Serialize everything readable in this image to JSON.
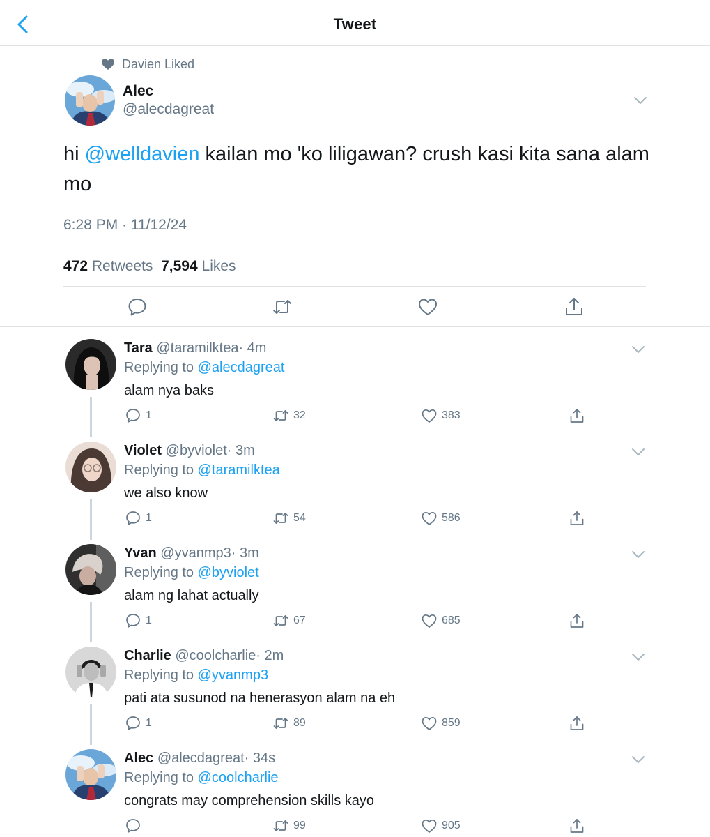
{
  "header": {
    "title": "Tweet"
  },
  "social_context": {
    "text": "Davien Liked"
  },
  "tweet": {
    "name": "Alec",
    "handle": "@alecdagreat",
    "text_prefix": "hi ",
    "mention": "@welldavien",
    "text_suffix": " kailan mo 'ko liligawan? crush kasi kita sana alam mo",
    "timestamp": "6:28 PM · 11/12/24",
    "retweets_count": "472",
    "retweets_label": "Retweets",
    "likes_count": "7,594",
    "likes_label": "Likes"
  },
  "replies": [
    {
      "name": "Tara",
      "handle": "@taramilktea",
      "time": "· 4m",
      "replying_label": "Replying to",
      "replying_to": "@alecdagreat",
      "text": "alam nya baks",
      "comments": "1",
      "retweets": "32",
      "likes": "383"
    },
    {
      "name": "Violet",
      "handle": "@byviolet",
      "time": "· 3m",
      "replying_label": "Replying to",
      "replying_to": "@taramilktea",
      "text": "we also know",
      "comments": "1",
      "retweets": "54",
      "likes": "586"
    },
    {
      "name": "Yvan",
      "handle": "@yvanmp3",
      "time": "· 3m",
      "replying_label": "Replying to",
      "replying_to": "@byviolet",
      "text": "alam ng lahat actually",
      "comments": "1",
      "retweets": "67",
      "likes": "685"
    },
    {
      "name": "Charlie",
      "handle": "@coolcharlie",
      "time": "· 2m",
      "replying_label": "Replying to",
      "replying_to": "@yvanmp3",
      "text": "pati ata susunod na henerasyon alam na eh",
      "comments": "1",
      "retweets": "89",
      "likes": "859"
    },
    {
      "name": "Alec",
      "handle": "@alecdagreat",
      "time": "· 34s",
      "replying_label": "Replying to",
      "replying_to": "@coolcharlie",
      "text": "congrats may comprehension skills kayo",
      "comments": "",
      "retweets": "99",
      "likes": "905"
    }
  ],
  "colors": {
    "accent": "#1da1f2",
    "secondary_text": "#657786",
    "icon": "#657786",
    "divider": "#dfe3e6"
  }
}
